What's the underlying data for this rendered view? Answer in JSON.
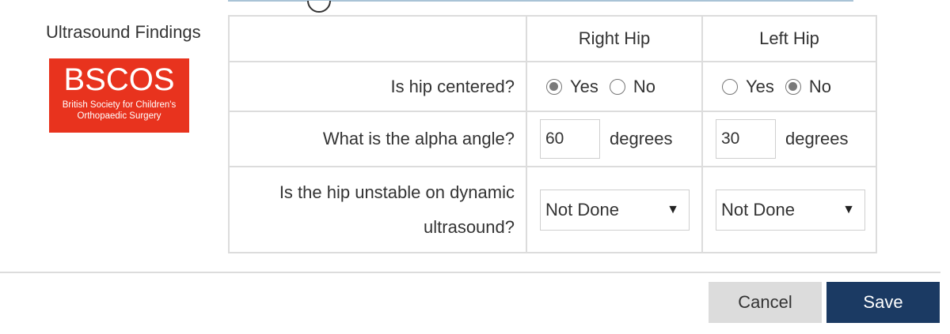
{
  "section": {
    "title": "Ultrasound Findings"
  },
  "logo": {
    "main": "BSCOS",
    "sub_line1": "British Society for Children's",
    "sub_line2": "Orthopaedic Surgery"
  },
  "table": {
    "headers": {
      "question": "",
      "right": "Right Hip",
      "left": "Left Hip"
    },
    "rows": {
      "centered": {
        "question": "Is hip centered?",
        "right": {
          "selected": "Yes",
          "yes": "Yes",
          "no": "No"
        },
        "left": {
          "selected": "No",
          "yes": "Yes",
          "no": "No"
        }
      },
      "alpha": {
        "question": "What is the alpha angle?",
        "right_value": "60",
        "left_value": "30",
        "unit": "degrees"
      },
      "dynamic": {
        "question_line1": "Is the hip unstable on dynamic",
        "question_line2": "ultrasound?",
        "right_value": "Not Done",
        "left_value": "Not Done"
      }
    }
  },
  "buttons": {
    "cancel": "Cancel",
    "save": "Save"
  },
  "colors": {
    "logo_bg": "#e8331e",
    "save_bg": "#1b3a63",
    "cancel_bg": "#dcdcdc"
  },
  "icons": {
    "select_caret": "▼"
  }
}
